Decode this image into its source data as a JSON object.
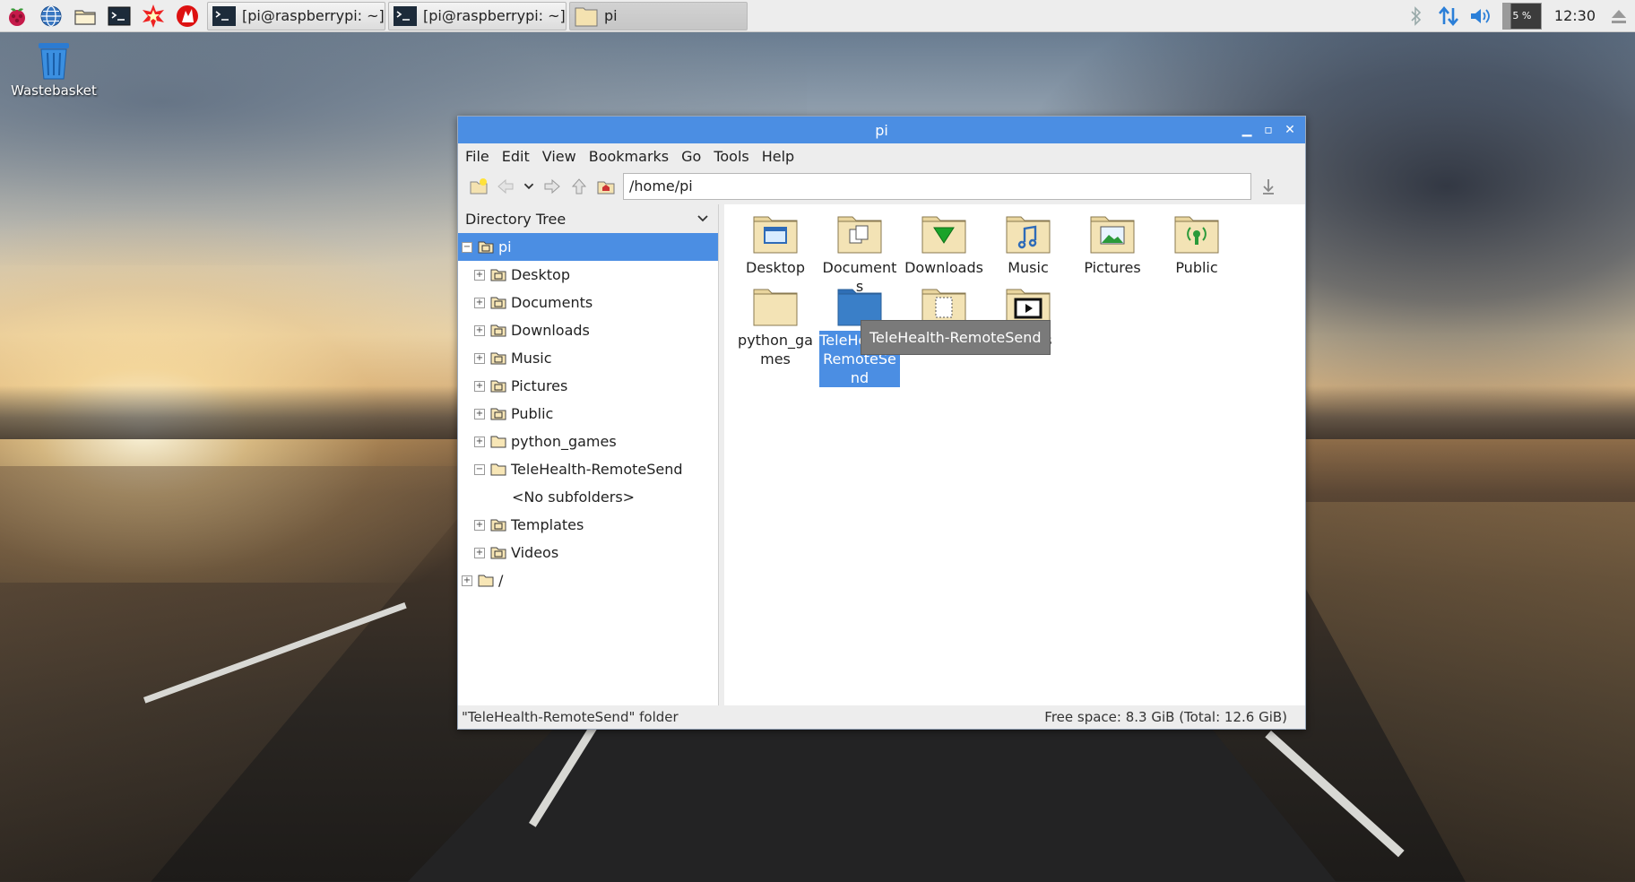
{
  "taskbar": {
    "launchers": [
      {
        "icon": "raspberry-menu-icon"
      },
      {
        "icon": "web-browser-icon"
      },
      {
        "icon": "file-manager-icon"
      },
      {
        "icon": "terminal-icon"
      },
      {
        "icon": "wolfram-icon"
      },
      {
        "icon": "mathematica-icon"
      }
    ],
    "tasks": [
      {
        "label": "[pi@raspberrypi: ~]",
        "icon": "terminal-icon"
      },
      {
        "label": "[pi@raspberrypi: ~]",
        "icon": "terminal-icon"
      },
      {
        "label": "pi",
        "icon": "folder-icon"
      }
    ],
    "cpu": "5 %",
    "clock": "12:30"
  },
  "desktop": {
    "wastebasket_label": "Wastebasket"
  },
  "window": {
    "title": "pi",
    "menu": [
      "File",
      "Edit",
      "View",
      "Bookmarks",
      "Go",
      "Tools",
      "Help"
    ],
    "path": "/home/pi",
    "side_header": "Directory Tree",
    "tree": [
      {
        "label": "pi",
        "expander": "−",
        "level": 0,
        "selected": true
      },
      {
        "label": "Desktop",
        "expander": "+",
        "level": 1
      },
      {
        "label": "Documents",
        "expander": "+",
        "level": 1
      },
      {
        "label": "Downloads",
        "expander": "+",
        "level": 1
      },
      {
        "label": "Music",
        "expander": "+",
        "level": 1
      },
      {
        "label": "Pictures",
        "expander": "+",
        "level": 1
      },
      {
        "label": "Public",
        "expander": "+",
        "level": 1
      },
      {
        "label": "python_games",
        "expander": "+",
        "level": 1
      },
      {
        "label": "TeleHealth-RemoteSend",
        "expander": "−",
        "level": 1
      },
      {
        "label": "<No subfolders>",
        "expander": "",
        "level": 2
      },
      {
        "label": "Templates",
        "expander": "+",
        "level": 1
      },
      {
        "label": "Videos",
        "expander": "+",
        "level": 1
      },
      {
        "label": "/",
        "expander": "+",
        "level": 0
      }
    ],
    "files": [
      {
        "name": "Desktop"
      },
      {
        "name": "Documents"
      },
      {
        "name": "Downloads"
      },
      {
        "name": "Music"
      },
      {
        "name": "Pictures"
      },
      {
        "name": "Public"
      },
      {
        "name": "python_games"
      },
      {
        "name": "TeleHealth-RemoteSend",
        "selected": true
      },
      {
        "name": "Templates"
      },
      {
        "name": "Videos"
      }
    ],
    "tooltip": "TeleHealth-RemoteSend",
    "status_left": "\"TeleHealth-RemoteSend\" folder",
    "status_right": "Free space: 8.3 GiB (Total: 12.6 GiB)"
  }
}
